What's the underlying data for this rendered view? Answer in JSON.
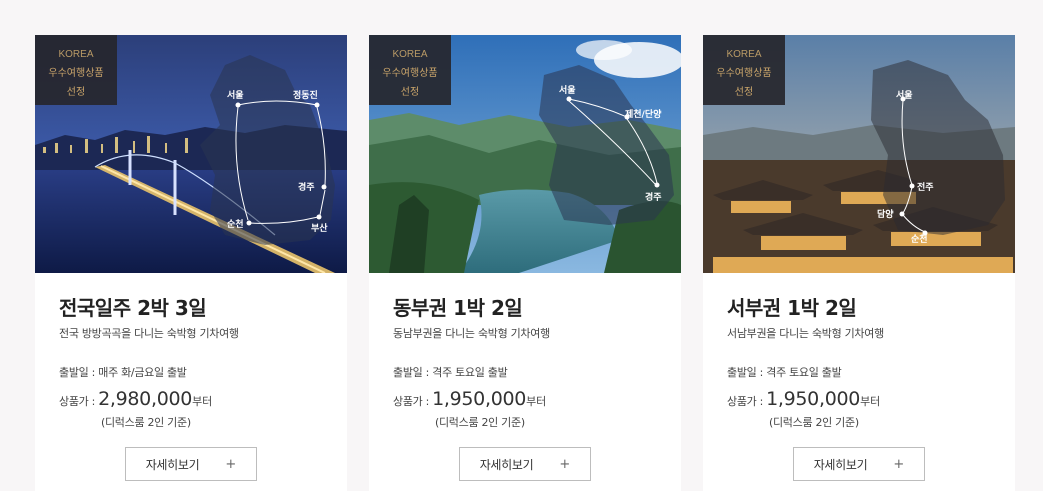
{
  "cards": [
    {
      "badge": [
        "KOREA",
        "우수여행상품",
        "선정"
      ],
      "title": "전국일주 2박 3일",
      "subtitle": "전국 방방곡곡을 다니는 숙박형 기차여행",
      "depart": "출발일 : 매주 화/금요일 출발",
      "price_label": "상품가 :",
      "price": "2,980,000",
      "price_suffix": "부터",
      "price_note": "(디럭스룸 2인 기준)",
      "button": "자세히보기",
      "button_icon": "+",
      "route": [
        "서울",
        "정동진",
        "경주",
        "부산",
        "순천"
      ]
    },
    {
      "badge": [
        "KOREA",
        "우수여행상품",
        "선정"
      ],
      "title": "동부권 1박 2일",
      "subtitle": "동남부권을 다니는 숙박형 기차여행",
      "depart": "출발일 : 격주 토요일 출발",
      "price_label": "상품가 :",
      "price": "1,950,000",
      "price_suffix": "부터",
      "price_note": "(디럭스룸 2인 기준)",
      "button": "자세히보기",
      "button_icon": "+",
      "route": [
        "서울",
        "제천/단양",
        "경주"
      ]
    },
    {
      "badge": [
        "KOREA",
        "우수여행상품",
        "선정"
      ],
      "title": "서부권 1박 2일",
      "subtitle": "서남부권을 다니는 숙박형 기차여행",
      "depart": "출발일 : 격주 토요일 출발",
      "price_label": "상품가 :",
      "price": "1,950,000",
      "price_suffix": "부터",
      "price_note": "(디럭스룸 2인 기준)",
      "button": "자세히보기",
      "button_icon": "+",
      "route": [
        "서울",
        "전주",
        "담양",
        "순천"
      ]
    }
  ]
}
